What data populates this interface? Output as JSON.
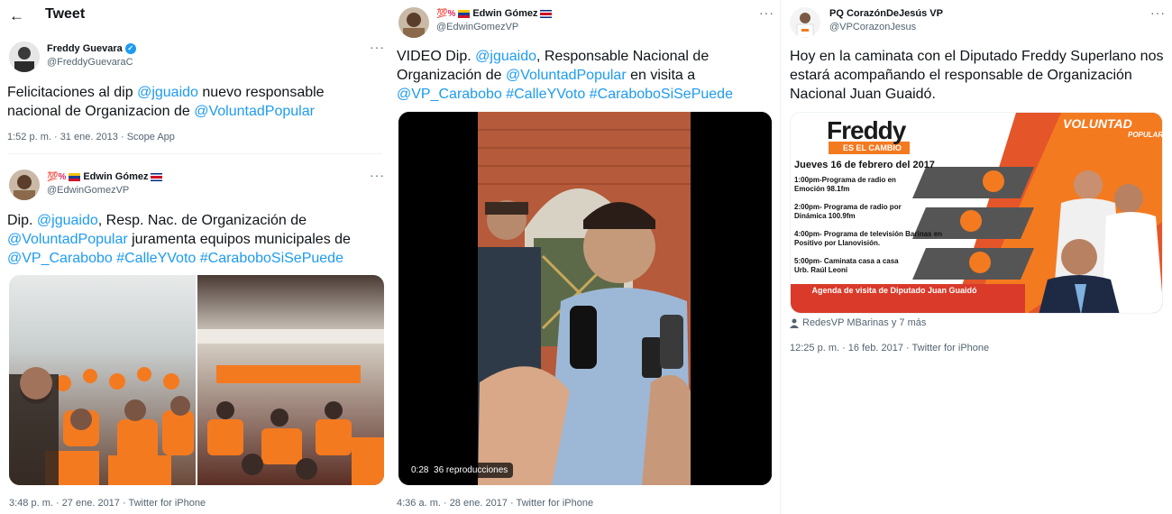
{
  "header": {
    "back_icon": "arrow-left-icon",
    "title": "Tweet"
  },
  "tweets": [
    {
      "name": "Freddy Guevara",
      "handle": "@FreddyGuevaraC",
      "text_parts": [
        "Felicitaciones al dip ",
        "@jguaido",
        " nuevo responsable nacional de Organizacion de ",
        "@VoluntadPopular"
      ],
      "meta": "1:52 p. m. · 31 ene. 2013 · Scope App"
    },
    {
      "name_prefix": "💯%",
      "name": "Edwin Gómez",
      "handle": "@EdwinGomezVP",
      "text_parts": [
        "Dip. ",
        "@jguaido",
        ", Resp. Nac. de Organización de ",
        "@VoluntadPopular",
        " juramenta equipos municipales de ",
        "@VP_Carabobo",
        " ",
        "#CalleYVoto",
        " ",
        "#CaraboboSiSePuede"
      ],
      "meta": "3:48 p. m. · 27 ene. 2017 · Twitter for iPhone"
    },
    {
      "name_prefix": "💯%",
      "name": "Edwin Gómez",
      "handle": "@EdwinGomezVP",
      "text_parts": [
        "VIDEO Dip. ",
        "@jguaido",
        ", Responsable Nacional de Organización de ",
        "@VoluntadPopular",
        " en visita a ",
        "@VP_Carabobo",
        " ",
        "#CalleYVoto",
        " ",
        "#CaraboboSiSePuede"
      ],
      "video_time": "0:28",
      "video_views": "36 reproducciones",
      "meta": "4:36 a. m. · 28 ene. 2017 · Twitter for iPhone"
    },
    {
      "name": "PQ CorazónDeJesús VP",
      "handle": "@VPCorazonJesus",
      "text": "Hoy en la caminata con el Diputado Freddy Superlano nos estará acompañando el responsable de Organización Nacional Juan Guaidó.",
      "tagged": "RedesVP MBarinas y 7 más",
      "meta": "12:25 p. m. · 16 feb. 2017 · Twitter for iPhone"
    }
  ],
  "flyer": {
    "brand": "Freddy",
    "brand_sub": "ES EL CAMBIO",
    "party": "VOLUNTAD",
    "party_sub": "POPULAR",
    "date": "Jueves 16 de febrero del 2017",
    "items": [
      "1:00pm-Programa de radio en Emoción 98.1fm",
      "2:00pm- Programa de radio por Dinámica 100.9fm",
      "4:00pm- Programa de televisión Barinas en Positivo por Llanovisión.",
      "5:00pm- Caminata casa a casa Urb. Raúl Leoni"
    ],
    "banner": "Agenda de visita de Diputado Juan Guaidó"
  },
  "colors": {
    "link": "#1d9bf0",
    "muted": "#536471",
    "orange": "#f47a20"
  },
  "more_icon": "more-dots-icon",
  "verified_icon": "verified-badge-icon"
}
